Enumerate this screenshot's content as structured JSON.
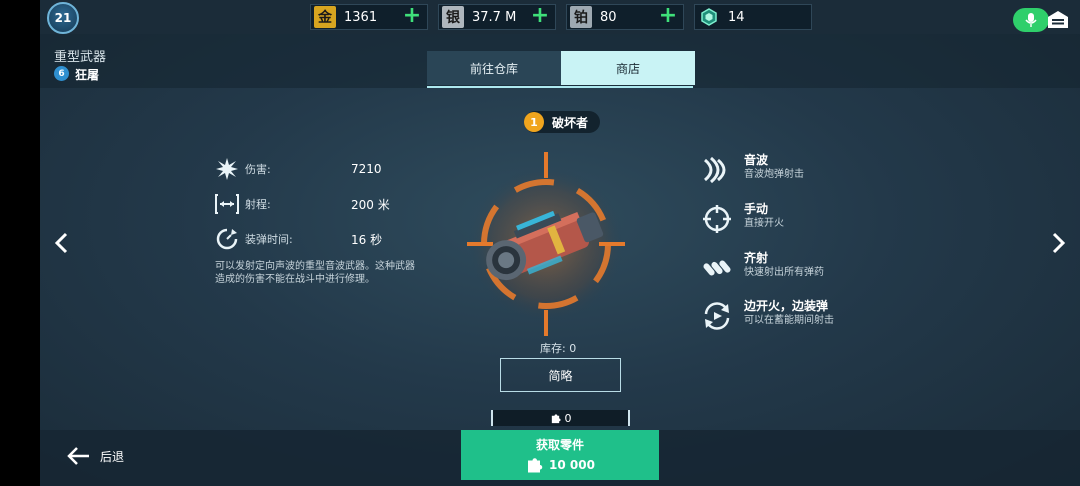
{
  "topbar": {
    "level": "21",
    "resources": [
      {
        "name": "gold",
        "icon_char": "金",
        "value": "1361"
      },
      {
        "name": "silver",
        "icon_char": "银",
        "value": "37.7 M"
      },
      {
        "name": "platinum",
        "icon_char": "铂",
        "value": "80"
      },
      {
        "name": "gem",
        "icon_char": "",
        "value": "14"
      }
    ],
    "plus_symbol": "+"
  },
  "header": {
    "category": "重型武器",
    "rank": "6",
    "subtitle": "狂屠"
  },
  "tabs": [
    {
      "label": "前往仓库",
      "active": false
    },
    {
      "label": "商店",
      "active": true
    }
  ],
  "weapon": {
    "tier": "1",
    "name": "破坏者",
    "stats": [
      {
        "label": "伤害:",
        "value": "7210"
      },
      {
        "label": "射程:",
        "value": "200 米"
      },
      {
        "label": "装弹时间:",
        "value": "16 秒"
      }
    ],
    "description": "可以发射定向声波的重型音波武器。这种武器造成的伤害不能在战斗中进行修理。",
    "stock": "库存: 0",
    "summary_label": "简略",
    "parts_count": "0"
  },
  "abilities": [
    {
      "name": "音波",
      "desc": "音波炮弹射击",
      "icon": "sonic-icon"
    },
    {
      "name": "手动",
      "desc": "直接开火",
      "icon": "crosshair-icon"
    },
    {
      "name": "齐射",
      "desc": "快速射出所有弹药",
      "icon": "salvo-icon"
    },
    {
      "name": "边开火，边装弹",
      "desc": "可以在蓄能期间射击",
      "icon": "reload-fire-icon"
    }
  ],
  "footer": {
    "back_label": "后退",
    "get_parts_label": "获取零件",
    "get_parts_cost": "10 000"
  },
  "colors": {
    "accent_green": "#1fc08a",
    "tier_orange": "#f0a51e",
    "tab_active": "#c9f3f5"
  }
}
